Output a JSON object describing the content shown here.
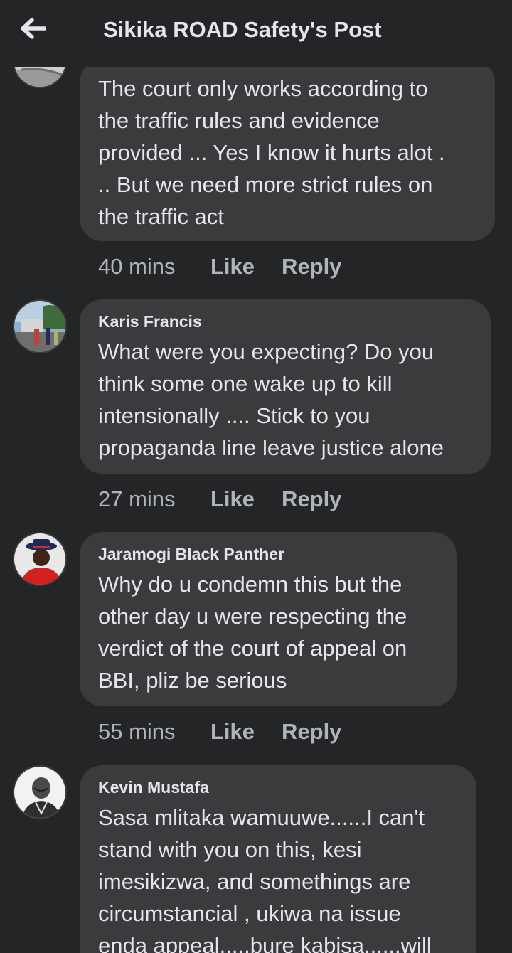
{
  "header": {
    "title": "Sikika ROAD Safety's Post",
    "back_icon": "arrow-left-icon"
  },
  "comments": [
    {
      "author": "",
      "text": "The court only works according to\nthe traffic rules and evidence\nprovided ... Yes I know it hurts alot .\n.. But we need more strict rules on\nthe traffic act",
      "time": "40 mins",
      "like_label": "Like",
      "reply_label": "Reply"
    },
    {
      "author": "Karis Francis",
      "text": "What were you expecting? Do you\nthink some one wake up to kill\nintensionally .... Stick to you\npropaganda line leave justice alone",
      "time": "27 mins",
      "like_label": "Like",
      "reply_label": "Reply"
    },
    {
      "author": "Jaramogi Black Panther",
      "text": "Why do u condemn this but the\nother day u were respecting the\nverdict of the court of appeal on\nBBI, pliz be serious",
      "time": "55 mins",
      "like_label": "Like",
      "reply_label": "Reply"
    },
    {
      "author": "Kevin Mustafa",
      "text": "Sasa mlitaka wamuuwe......I can't\nstand with you on this, kesi\nimesikizwa, and somethings are\ncircumstancial , ukiwa na issue\nenda appeal.....bure kabisa......will",
      "time": "",
      "like_label": "",
      "reply_label": ""
    }
  ],
  "colors": {
    "background": "#242526",
    "bubble": "#3a3b3c",
    "text": "#e4e6eb",
    "secondary_text": "#b0b3b8"
  }
}
